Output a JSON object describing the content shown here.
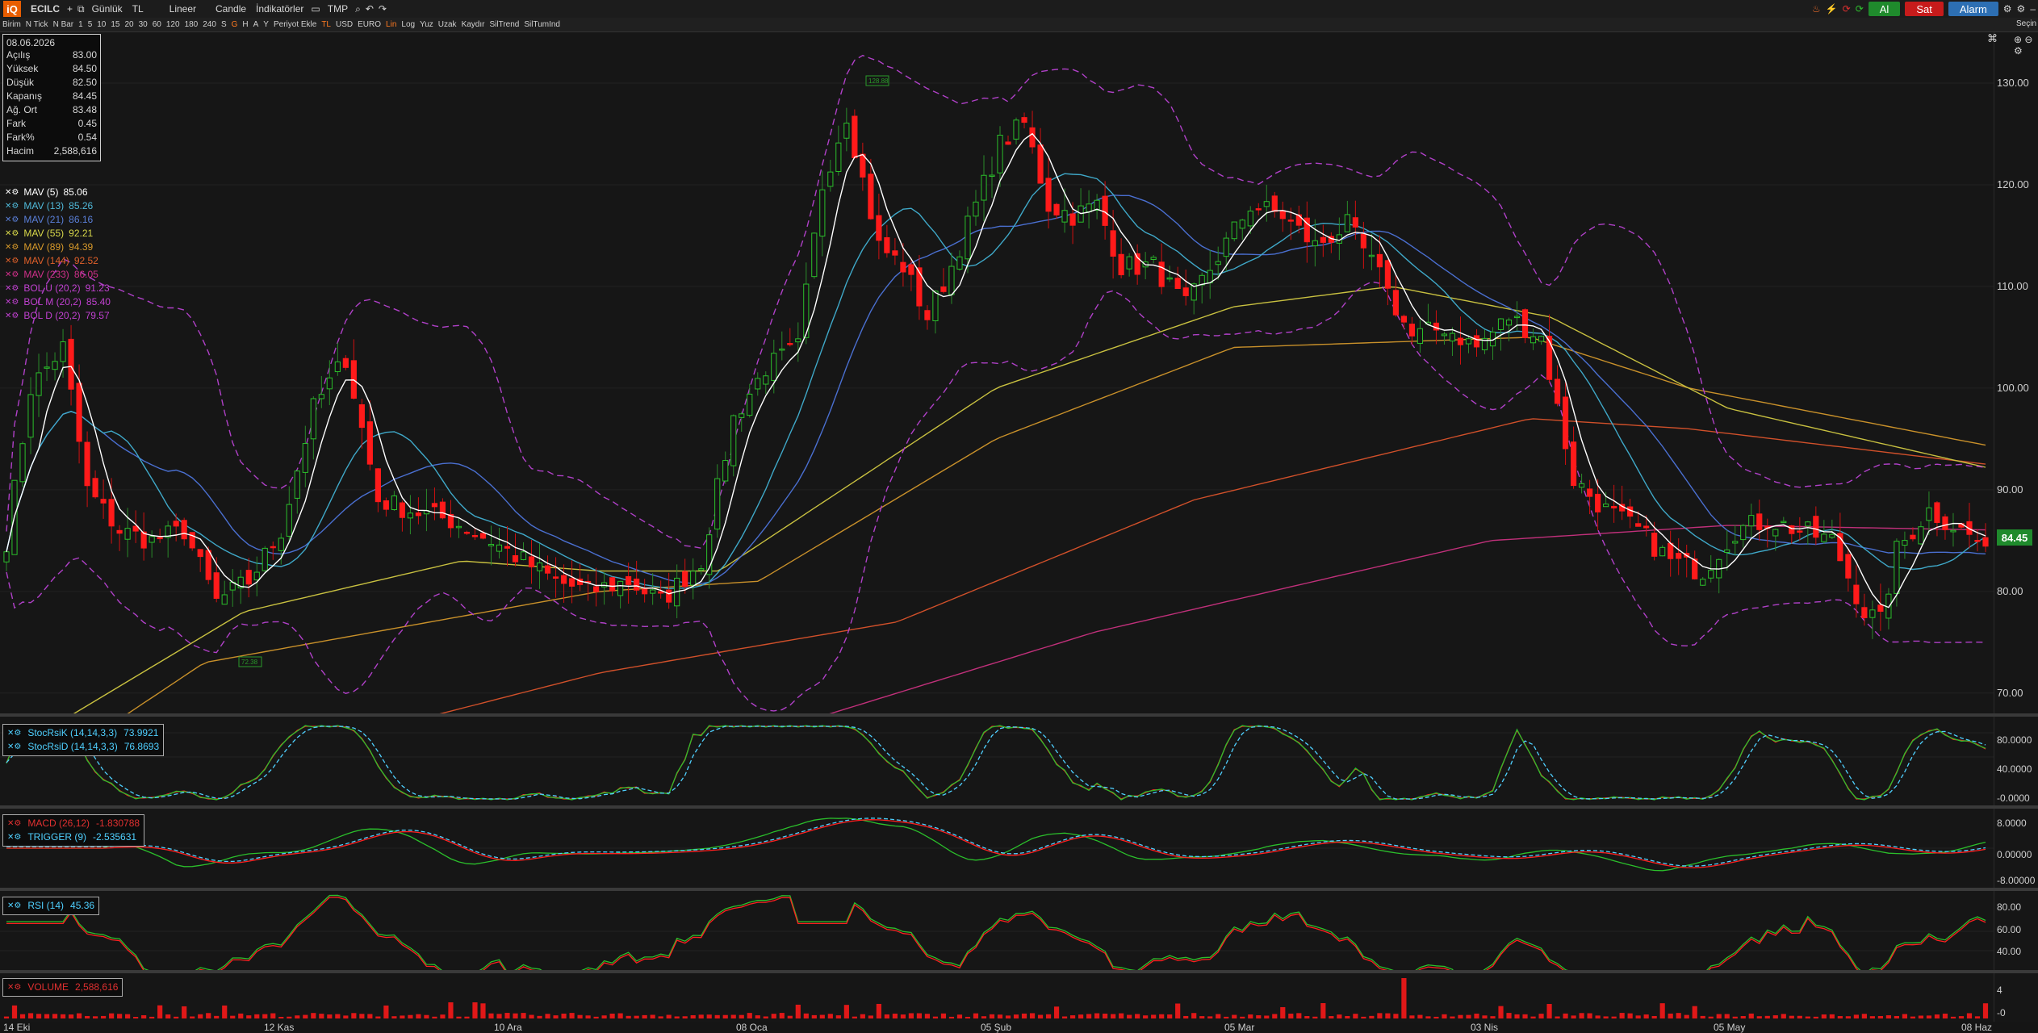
{
  "toolbar": {
    "symbol": "ECILC",
    "plus": "+",
    "period": "Günlük",
    "currency": "TL",
    "scale_mode": "Lineer",
    "chart_style": "Candle",
    "indicators": "İndikatörler",
    "tmp": "TMP",
    "buy": "Al",
    "sell": "Sat",
    "alarm": "Alarm",
    "right_label": "Seçin"
  },
  "toolbar2": {
    "items": [
      "Birim",
      "N Tick",
      "N Bar",
      "1",
      "5",
      "10",
      "15",
      "20",
      "30",
      "60",
      "120",
      "180",
      "240",
      "S",
      "G",
      "H",
      "A",
      "Y",
      "Periyot Ekle",
      "TL",
      "USD",
      "EURO",
      "Lin",
      "Log",
      "Yuz",
      "Uzak",
      "Kaydır",
      "SilTrend",
      "SilTumInd"
    ],
    "highlighted": [
      "G",
      "TL",
      "Lin"
    ]
  },
  "ohlc": {
    "date": "08.06.2026",
    "rows": [
      {
        "label": "Açılış",
        "value": "83.00"
      },
      {
        "label": "Yüksek",
        "value": "84.50"
      },
      {
        "label": "Düşük",
        "value": "82.50"
      },
      {
        "label": "Kapanış",
        "value": "84.45"
      },
      {
        "label": "Ağ. Ort",
        "value": "83.48"
      },
      {
        "label": "Fark",
        "value": "0.45"
      },
      {
        "label": "Fark%",
        "value": "0.54"
      },
      {
        "label": "Hacim",
        "value": "2,588,616"
      }
    ]
  },
  "legend": [
    {
      "name": "MAV (5)",
      "value": "85.06",
      "color": "#ffffff"
    },
    {
      "name": "MAV (13)",
      "value": "85.26",
      "color": "#4fb8d8"
    },
    {
      "name": "MAV (21)",
      "value": "86.16",
      "color": "#5a7fd8"
    },
    {
      "name": "MAV (55)",
      "value": "92.21",
      "color": "#d8d84a"
    },
    {
      "name": "MAV (89)",
      "value": "94.39",
      "color": "#d89a2a"
    },
    {
      "name": "MAV (144)",
      "value": "92.52",
      "color": "#e0602a"
    },
    {
      "name": "MAV (233)",
      "value": "86.05",
      "color": "#d0308a"
    },
    {
      "name": "BOL U (20,2)",
      "value": "91.23",
      "color": "#c040d0"
    },
    {
      "name": "BOL M (20,2)",
      "value": "85.40",
      "color": "#c040d0"
    },
    {
      "name": "BOL D (20,2)",
      "value": "79.57",
      "color": "#c040d0"
    }
  ],
  "price_axis": [
    "130.00",
    "120.00",
    "110.00",
    "100.00",
    "90.00",
    "80.00",
    "70.00"
  ],
  "last_price": "84.45",
  "annotations": {
    "high_marker": "128.88",
    "low_marker": "72.38"
  },
  "stoch": {
    "lines": [
      {
        "name": "StocRsiK (14,14,3,3)",
        "value": "73.9921",
        "color": "#4fd0ff"
      },
      {
        "name": "StocRsiD (14,14,3,3)",
        "value": "76.8693",
        "color": "#4fd0ff"
      }
    ],
    "axis": [
      "80.0000",
      "40.0000",
      "-0.0000"
    ]
  },
  "macd": {
    "lines": [
      {
        "name": "MACD (26,12)",
        "value": "-1.830788",
        "color": "#e03030"
      },
      {
        "name": "TRIGGER (9)",
        "value": "-2.535631",
        "color": "#4fd0ff"
      }
    ],
    "axis": [
      "8.0000",
      "0.00000",
      "-8.00000"
    ]
  },
  "rsi": {
    "lines": [
      {
        "name": "RSI (14)",
        "value": "45.36",
        "color": "#4fd0ff"
      }
    ],
    "axis": [
      "80.00",
      "60.00",
      "40.00"
    ]
  },
  "volume": {
    "lines": [
      {
        "name": "VOLUME",
        "value": "2,588,616",
        "color": "#e03030"
      }
    ],
    "axis": [
      "4",
      "-0"
    ]
  },
  "dates": [
    "14 Eki",
    "12 Kas",
    "10 Ara",
    "08 Oca",
    "05 Şub",
    "05 Mar",
    "03 Nis",
    "05 May",
    "08 Haz"
  ],
  "chart_data": {
    "type": "line",
    "title": "",
    "xlabel": "",
    "ylabel": "",
    "ylim": [
      68,
      135
    ],
    "x": [
      "14 Eki",
      "12 Kas",
      "10 Ara",
      "08 Oca",
      "05 Şub",
      "05 Mar",
      "03 Nis",
      "05 May",
      "08 Haz"
    ],
    "series": [
      {
        "name": "MAV (5)",
        "values": [
          90,
          96,
          82,
          84,
          114,
          112,
          104,
          84,
          85.06
        ]
      },
      {
        "name": "MAV (55)",
        "values": [
          68,
          84,
          82,
          82,
          100,
          108,
          108,
          99,
          92.21
        ]
      },
      {
        "name": "MAV (144)",
        "values": [
          58,
          66,
          74,
          75,
          82,
          90,
          96,
          95,
          92.52
        ]
      },
      {
        "name": "MAV (233)",
        "values": [
          50,
          56,
          60,
          64,
          73,
          80,
          84,
          86,
          86.05
        ]
      }
    ]
  }
}
